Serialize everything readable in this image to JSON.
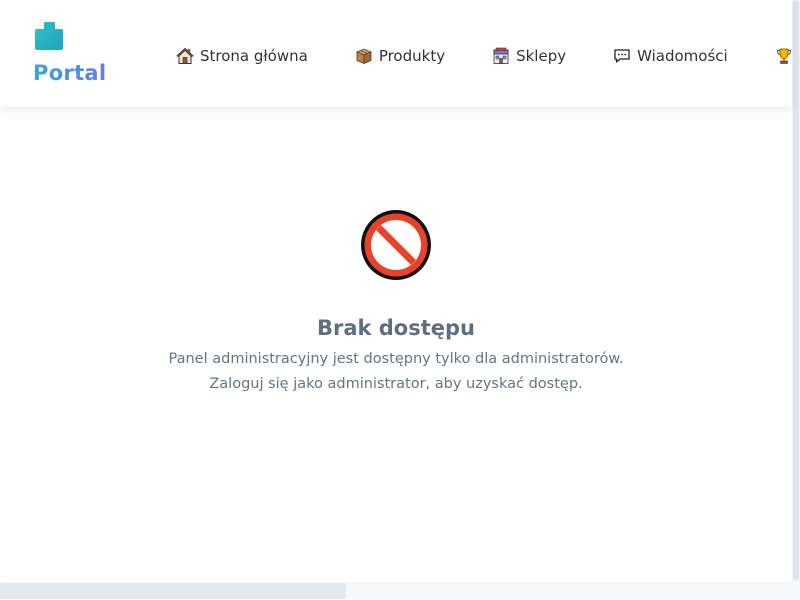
{
  "brand": {
    "name": "Portal"
  },
  "nav": {
    "items": [
      {
        "label": "Strona główna",
        "icon": "home-icon"
      },
      {
        "label": "Produkty",
        "icon": "box-icon"
      },
      {
        "label": "Sklepy",
        "icon": "store-icon"
      },
      {
        "label": "Wiadomości",
        "icon": "message-icon"
      },
      {
        "label": "",
        "icon": "trophy-icon"
      }
    ]
  },
  "access_denied": {
    "icon": "prohibited-icon",
    "title": "Brak dostępu",
    "message_line1": "Panel administracyjny jest dostępny tylko dla administratorów.",
    "message_line2": "Zaloguj się jako administrator, aby uzyskać dostęp."
  },
  "colors": {
    "brand_gradient_start": "#3aa6d6",
    "brand_gradient_end": "#6a78e4",
    "title": "#5f6e82",
    "text": "#667487",
    "prohibited": "#e8432a"
  }
}
